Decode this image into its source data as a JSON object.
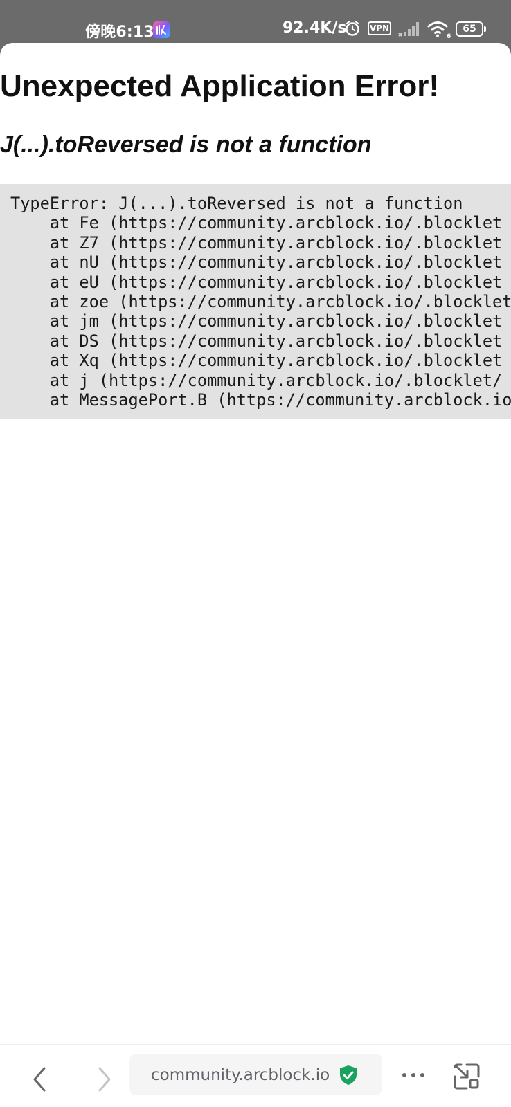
{
  "status_bar": {
    "time": "傍晚6:13",
    "net_speed": "92.4K/s",
    "vpn": "VPN",
    "battery": "65",
    "wifi_badge": "6"
  },
  "page": {
    "title": "Unexpected Application Error!",
    "message": "J(...).toReversed is not a function",
    "stack": [
      "TypeError: J(...).toReversed is not a function",
      "    at Fe (https://community.arcblock.io/.blocklet",
      "    at Z7 (https://community.arcblock.io/.blocklet",
      "    at nU (https://community.arcblock.io/.blocklet",
      "    at eU (https://community.arcblock.io/.blocklet",
      "    at zoe (https://community.arcblock.io/.blocklet",
      "    at jm (https://community.arcblock.io/.blocklet",
      "    at DS (https://community.arcblock.io/.blocklet",
      "    at Xq (https://community.arcblock.io/.blocklet",
      "    at j (https://community.arcblock.io/.blocklet/",
      "    at MessagePort.B (https://community.arcblock.io"
    ]
  },
  "browser_bar": {
    "url": "community.arcblock.io",
    "icons": {
      "back": "chevron-left-icon",
      "forward": "chevron-right-icon",
      "secure": "shield-check-icon",
      "more": "more-horizontal-icon",
      "window": "exit-fullscreen-icon"
    },
    "secure_color": "#1aa260"
  }
}
